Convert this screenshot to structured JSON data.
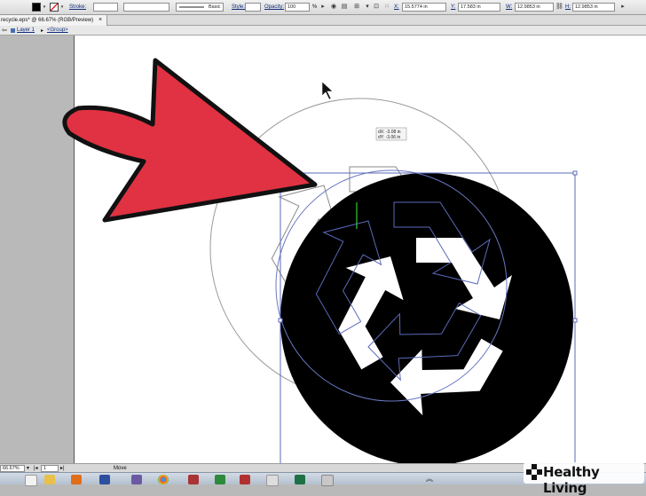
{
  "control_bar": {
    "stroke_label": "Stroke:",
    "stroke_profile": "Basic",
    "style_label": "Style:",
    "opacity_label": "Opacity:",
    "opacity_value": "100",
    "opacity_unit": "%",
    "x_label": "X:",
    "x_value": "15.5774 in",
    "y_label": "Y:",
    "y_value": "17.583 in",
    "w_label": "W:",
    "w_value": "12.9853 in",
    "h_label": "H:",
    "h_value": "12.9853 in"
  },
  "document": {
    "tab_title": "recycle.eps* @ 66.67% (RGB/Preview)",
    "close_glyph": "×"
  },
  "breadcrumb": {
    "layer": "Layer 1",
    "group": "<Group>"
  },
  "tooltip": {
    "dx": "dX: -3.08 in",
    "dy": "dY: -3.06 in"
  },
  "status_bar": {
    "zoom": "66.67%",
    "page": "1",
    "tool": "Move"
  },
  "watermark": {
    "brand": "Healthy Living"
  },
  "colors": {
    "arrow_fill": "#e03242",
    "recycle_disc": "#000000",
    "selection": "#5a6ab8",
    "fill_swatch": "#000000"
  }
}
